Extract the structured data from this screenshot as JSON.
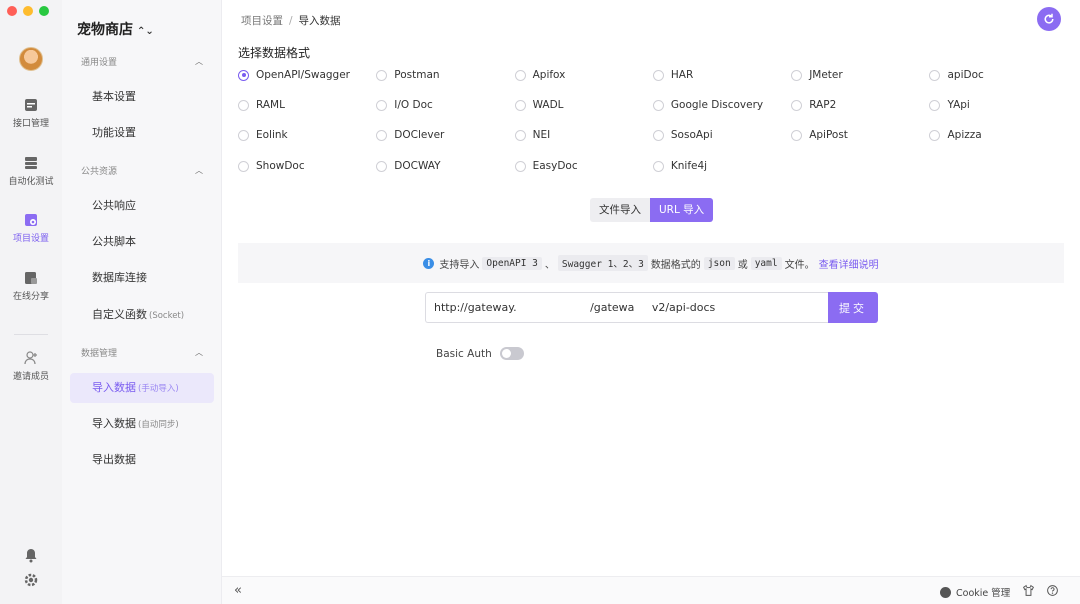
{
  "window": {
    "traffic_colors": [
      "#ff5f57",
      "#febc2e",
      "#28c840"
    ]
  },
  "rail": {
    "items": [
      {
        "label": "接口管理",
        "icon": "api-icon"
      },
      {
        "label": "自动化测试",
        "icon": "automation-icon"
      },
      {
        "label": "项目设置",
        "icon": "project-settings-icon",
        "active": true
      },
      {
        "label": "在线分享",
        "icon": "share-icon"
      },
      {
        "label": "邀请成员",
        "icon": "invite-member-icon"
      }
    ],
    "bottom_icons": [
      "bell-icon",
      "gear-icon"
    ]
  },
  "sidebar": {
    "title": "宠物商店",
    "groups": [
      {
        "label": "通用设置",
        "items": [
          {
            "label": "基本设置",
            "sub": ""
          },
          {
            "label": "功能设置",
            "sub": ""
          }
        ]
      },
      {
        "label": "公共资源",
        "items": [
          {
            "label": "公共响应",
            "sub": ""
          },
          {
            "label": "公共脚本",
            "sub": ""
          },
          {
            "label": "数据库连接",
            "sub": ""
          },
          {
            "label": "自定义函数",
            "sub": "(Socket)"
          }
        ]
      },
      {
        "label": "数据管理",
        "items": [
          {
            "label": "导入数据",
            "sub": "(手动导入)",
            "active": true
          },
          {
            "label": "导入数据",
            "sub": "(自动同步)"
          },
          {
            "label": "导出数据",
            "sub": ""
          }
        ]
      }
    ]
  },
  "breadcrumb": {
    "parent": "项目设置",
    "separator": "/",
    "current": "导入数据"
  },
  "section_title": "选择数据格式",
  "formats": [
    [
      "OpenAPI/Swagger",
      "Postman",
      "Apifox",
      "HAR",
      "JMeter",
      "apiDoc"
    ],
    [
      "RAML",
      "I/O Doc",
      "WADL",
      "Google Discovery",
      "RAP2",
      "YApi"
    ],
    [
      "Eolink",
      "DOClever",
      "NEI",
      "SosoApi",
      "ApiPost",
      "Apizza"
    ],
    [
      "ShowDoc",
      "DOCWAY",
      "EasyDoc",
      "Knife4j"
    ]
  ],
  "selected_format": "OpenAPI/Swagger",
  "import_modes": {
    "file": "文件导入",
    "url": "URL 导入",
    "active": "url"
  },
  "info": {
    "prefix": "支持导入",
    "code1": "OpenAPI 3",
    "sep": "、",
    "code2": "Swagger 1、2、3",
    "mid": "数据格式的",
    "code3": "json",
    "or": "或",
    "code4": "yaml",
    "suffix": "文件。",
    "link": "查看详细说明"
  },
  "url_input": {
    "value": "http://gateway.                     /gatewa     v2/api-docs"
  },
  "submit_label": "提交",
  "basic_auth": {
    "label": "Basic Auth",
    "enabled": false
  },
  "footer": {
    "collapse": "«",
    "cookie_label": "Cookie 管理"
  },
  "accent_color": "#8b6cf2"
}
